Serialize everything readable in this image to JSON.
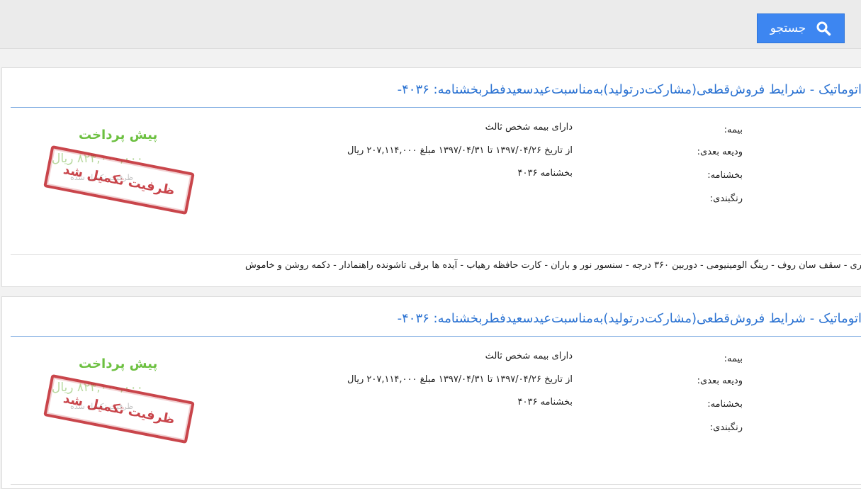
{
  "search": {
    "label": "جستجو"
  },
  "colors": {
    "accent": "#3d86f1",
    "title": "#2c73d2",
    "stamp": "#c0252c",
    "prepay": "#6cc040"
  },
  "cards": [
    {
      "title": "اتوماتیک - شرایط فروش‌قطعی(مشارکت‌درتولید)به‌مناسبت‌عیدسعیدفطربخشنامه: ۴۰۳۶-",
      "insurance_label": "بیمه:",
      "insurance_value": "دارای بیمه شخص ثالث",
      "deposit_label": "ودیعه بعدی:",
      "deposit_value": "از تاریخ ۱۳۹۷/۰۴/۲۶ تا ۱۳۹۷/۰۴/۳۱ مبلغ ۲۰۷,۱۱۴,۰۰۰ ریال",
      "circular_label": "بخشنامه:",
      "circular_value": "بخشنامه ۴۰۳۶",
      "color_label": "رنگبندی:",
      "prepay_label": "پیش پرداخت",
      "prepay_amount": "۸۲۴,۰۰۰,۰۰۰ ریال",
      "prepay_sub": "ظرفیت تکمیل شده",
      "stamp_text": "ظرفیت تکمیل شد",
      "features": "ری - سقف سان روف - رینگ الومینیومی - دوربین ۳۶۰ درجه - سنسور نور و باران - کارت حافظه رهیاب - آیده ها برقی تاشونده راهنمادار - دکمه روشن و خاموش"
    },
    {
      "title": "اتوماتیک - شرایط فروش‌قطعی(مشارکت‌درتولید)به‌مناسبت‌عیدسعیدفطربخشنامه: ۴۰۳۶-",
      "insurance_label": "بیمه:",
      "insurance_value": "دارای بیمه شخص ثالث",
      "deposit_label": "ودیعه بعدی:",
      "deposit_value": "از تاریخ ۱۳۹۷/۰۴/۲۶ تا ۱۳۹۷/۰۴/۳۱ مبلغ ۲۰۷,۱۱۴,۰۰۰ ریال",
      "circular_label": "بخشنامه:",
      "circular_value": "بخشنامه ۴۰۳۶",
      "color_label": "رنگبندی:",
      "prepay_label": "پیش پرداخت",
      "prepay_amount": "۸۲۴,۰۰۰,۰۰۰ ریال",
      "prepay_sub": "ظرفیت تکمیل شده",
      "stamp_text": "ظرفیت تکمیل شد"
    }
  ]
}
